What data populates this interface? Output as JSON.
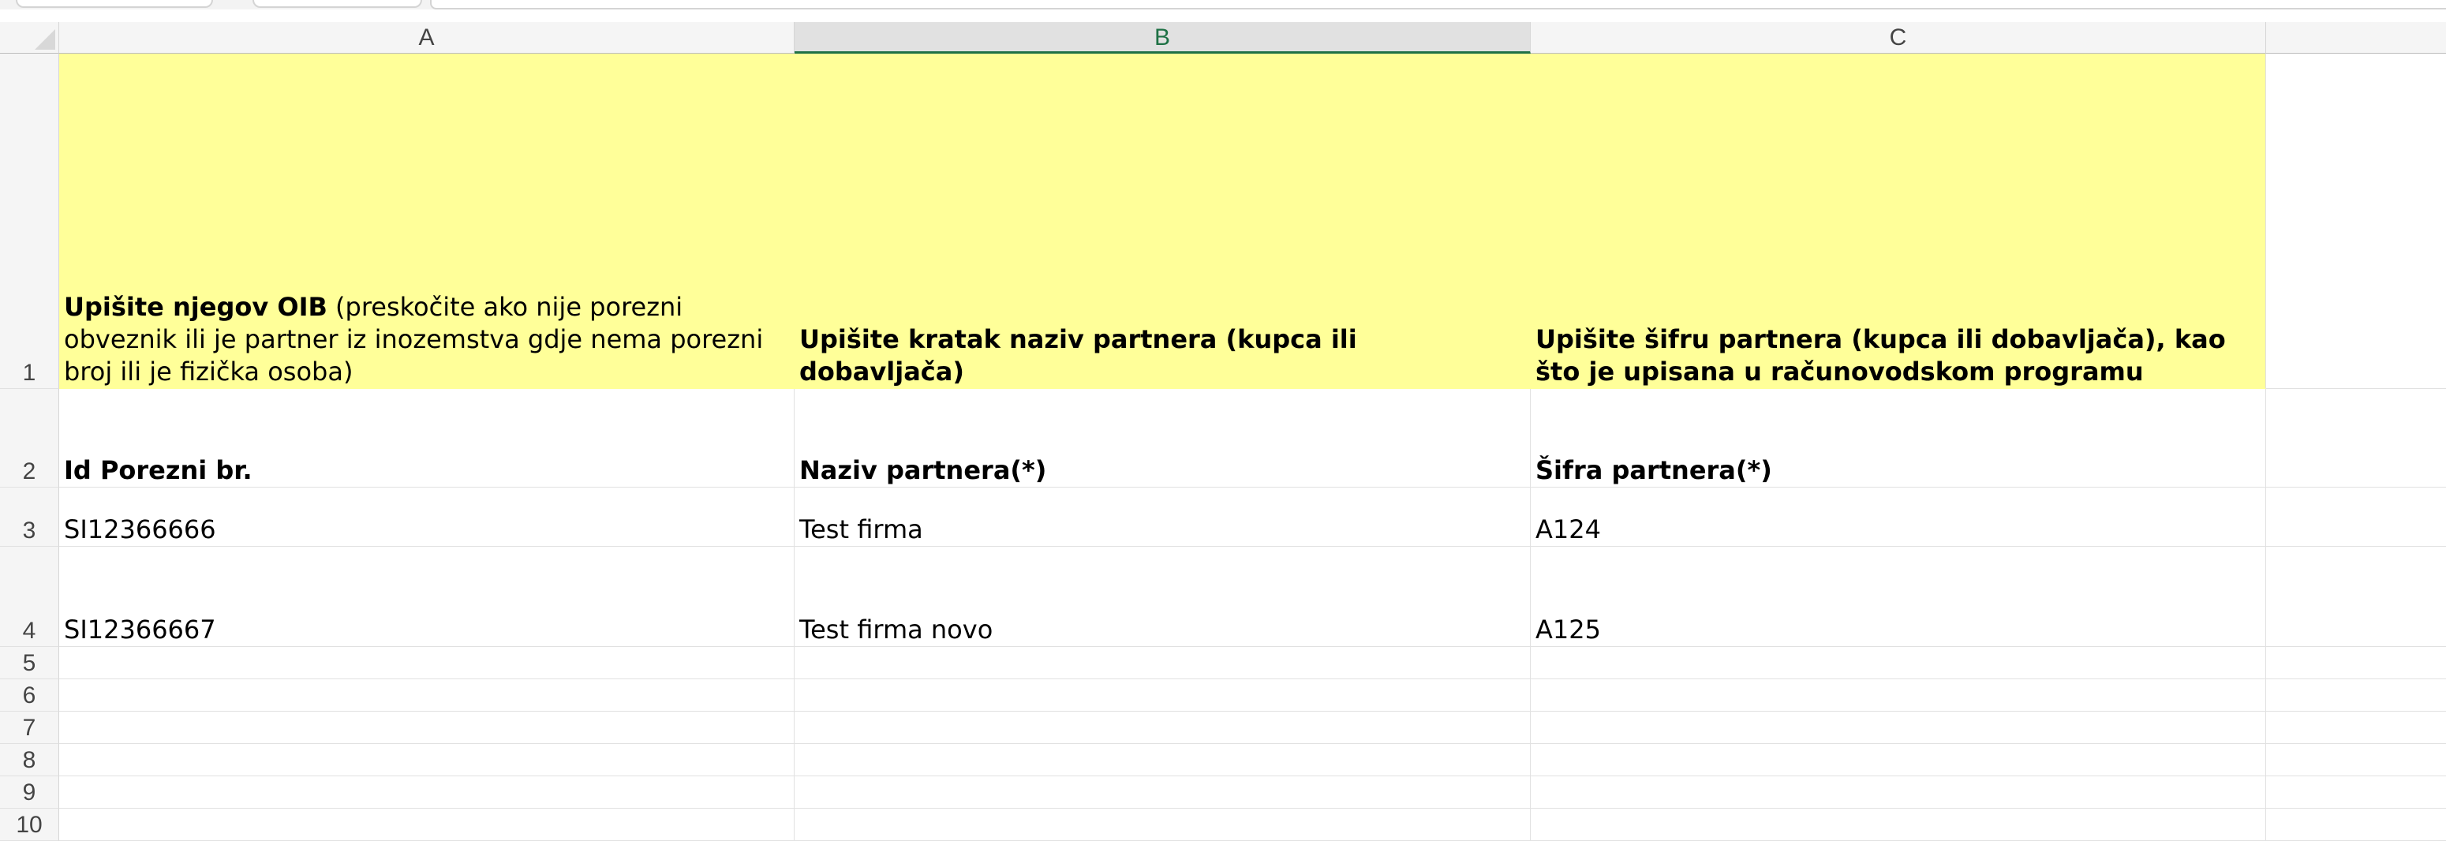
{
  "sheet": {
    "columns": [
      "A",
      "B",
      "C"
    ],
    "selected_column": "B",
    "row_numbers": [
      "1",
      "2",
      "3",
      "4",
      "5",
      "6",
      "7",
      "8",
      "9",
      "10"
    ],
    "highlight_color": "#ffff99",
    "accent_color": "#1e7145",
    "instructions": {
      "a_bold": "Upišite njegov OIB",
      "a_rest": " (preskočite ako nije porezni obveznik ili je partner iz inozemstva gdje nema porezni broj ili je fizička osoba)",
      "b": "Upišite kratak naziv partnera (kupca ili dobavljača)",
      "c": "Upišite šifru partnera (kupca ili dobavljača), kao što je upisana u računovodskom programu"
    },
    "headers": {
      "a": "Id Porezni br.",
      "b": "Naziv partnera(*)",
      "c": "Šifra partnera(*)"
    },
    "rows": [
      {
        "a": "SI12366666",
        "b": "Test firma",
        "c": "A124"
      },
      {
        "a": "SI12366667",
        "b": "Test firma novo",
        "c": "A125"
      }
    ]
  }
}
